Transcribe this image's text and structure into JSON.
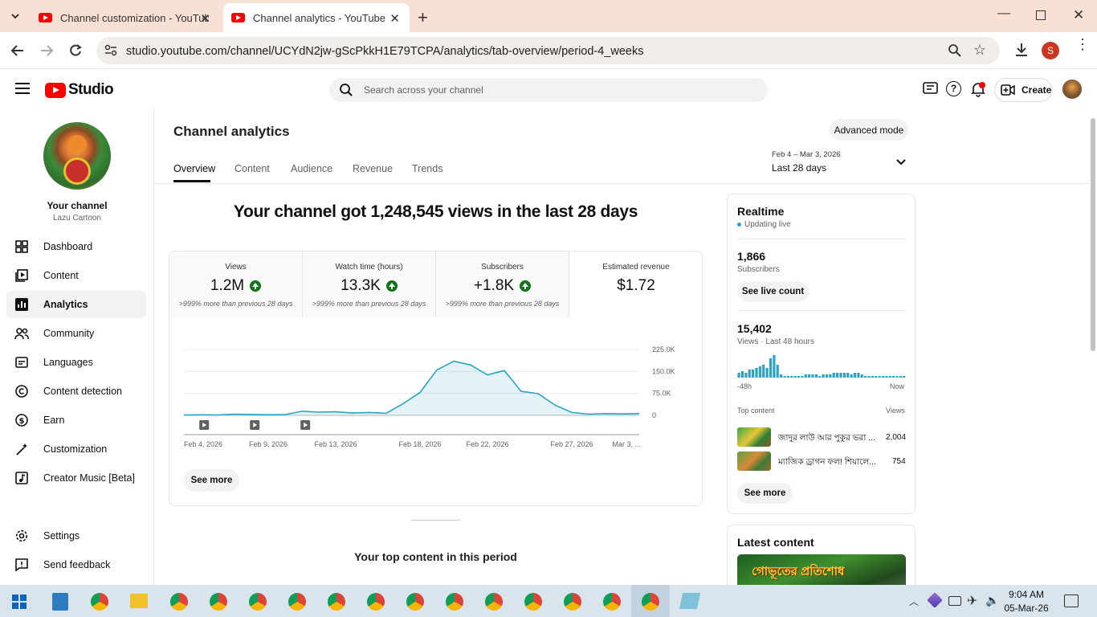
{
  "browser": {
    "tabs": [
      {
        "title": "Channel customization - YouTube Studio",
        "active": false
      },
      {
        "title": "Channel analytics - YouTube Studio",
        "active": true
      }
    ],
    "url": "studio.youtube.com/channel/UCYdN2jw-gScPkkH1E79TCPA/analytics/tab-overview/period-4_weeks",
    "profile_initial": "S"
  },
  "header": {
    "logo_text": "Studio",
    "search_placeholder": "Search across your channel",
    "create_label": "Create"
  },
  "sidebar": {
    "channel_title": "Your channel",
    "channel_name": "Lazu Cartoon",
    "items": [
      {
        "label": "Dashboard",
        "icon": "dashboard-icon"
      },
      {
        "label": "Content",
        "icon": "content-icon"
      },
      {
        "label": "Analytics",
        "icon": "analytics-icon",
        "active": true
      },
      {
        "label": "Community",
        "icon": "community-icon"
      },
      {
        "label": "Languages",
        "icon": "languages-icon"
      },
      {
        "label": "Content detection",
        "icon": "copyright-icon"
      },
      {
        "label": "Earn",
        "icon": "earn-icon"
      },
      {
        "label": "Customization",
        "icon": "customization-icon"
      },
      {
        "label": "Creator Music [Beta]",
        "icon": "music-icon"
      }
    ],
    "bottom": [
      {
        "label": "Settings",
        "icon": "settings-icon"
      },
      {
        "label": "Send feedback",
        "icon": "feedback-icon"
      }
    ]
  },
  "main": {
    "title": "Channel analytics",
    "advanced_mode": "Advanced mode",
    "date_range_small": "Feb 4 – Mar 3, 2026",
    "date_range_label": "Last 28 days",
    "tabs": [
      "Overview",
      "Content",
      "Audience",
      "Revenue",
      "Trends"
    ],
    "headline": "Your channel got 1,248,545 views in the last 28 days",
    "metrics": [
      {
        "label": "Views",
        "value": "1.2M",
        "sub": ">999% more than previous 28 days",
        "up": true
      },
      {
        "label": "Watch time (hours)",
        "value": "13.3K",
        "sub": ">999% more than previous 28 days",
        "up": true
      },
      {
        "label": "Subscribers",
        "value": "+1.8K",
        "sub": ">999% more than previous 28 days",
        "up": true
      },
      {
        "label": "Estimated revenue",
        "value": "$1.72",
        "sub": "",
        "up": false
      }
    ],
    "see_more": "See more",
    "top_content_heading": "Your top content in this period"
  },
  "chart_data": {
    "type": "area",
    "x": [
      "Feb 4",
      "Feb 5",
      "Feb 6",
      "Feb 7",
      "Feb 8",
      "Feb 9",
      "Feb 10",
      "Feb 11",
      "Feb 12",
      "Feb 13",
      "Feb 14",
      "Feb 15",
      "Feb 16",
      "Feb 17",
      "Feb 18",
      "Feb 19",
      "Feb 20",
      "Feb 21",
      "Feb 22",
      "Feb 23",
      "Feb 24",
      "Feb 25",
      "Feb 26",
      "Feb 27",
      "Feb 28",
      "Mar 1",
      "Mar 2",
      "Mar 3"
    ],
    "series": [
      {
        "values": [
          1000,
          2000,
          1500,
          4000,
          3000,
          2000,
          2500,
          14000,
          11000,
          12000,
          8000,
          10000,
          7000,
          40000,
          78000,
          155000,
          185000,
          172000,
          138000,
          153000,
          82000,
          74000,
          35000,
          10000,
          4000,
          6000,
          5000,
          6000
        ]
      }
    ],
    "tick_labels_x": [
      "Feb 4, 2026",
      "Feb 9, 2026",
      "Feb 13, 2026",
      "Feb 18, 2026",
      "Feb 22, 2026",
      "Feb 27, 2026",
      "Mar 3, ..."
    ],
    "tick_labels_y": [
      "225.0K",
      "150.0K",
      "75.0K",
      "0"
    ],
    "ylim": [
      0,
      225000
    ],
    "grid": true,
    "color": "#2ba3c2"
  },
  "realtime": {
    "title": "Realtime",
    "status": "Updating live",
    "subs_value": "1,866",
    "subs_label": "Subscribers",
    "see_live": "See live count",
    "views_value": "15,402",
    "views_label": "Views · Last 48 hours",
    "left_label": "-48h",
    "right_label": "Now",
    "bars": [
      3,
      4,
      3,
      5,
      5,
      6,
      7,
      8,
      6,
      12,
      14,
      8,
      2,
      1,
      1,
      1,
      1,
      1,
      1,
      2,
      2,
      2,
      2,
      1,
      2,
      2,
      2,
      3,
      3,
      3,
      3,
      3,
      2,
      3,
      3,
      2,
      1,
      1,
      1,
      1,
      1,
      1,
      1,
      1,
      1,
      1,
      1,
      1
    ],
    "top_content_label": "Top content",
    "views_col": "Views",
    "top_items": [
      {
        "title": "জাদুর লাউ আর পুকুর ভরা ...",
        "views": "2,004"
      },
      {
        "title": "ম্যাজিক ড্রাগন ফল! শিয়ালে...",
        "views": "754"
      }
    ],
    "see_more": "See more"
  },
  "latest": {
    "title": "Latest content",
    "thumb_text": "গোভূতের প্রতিশোধ"
  },
  "taskbar": {
    "time": "9:04 AM",
    "date": "05-Mar-26"
  }
}
